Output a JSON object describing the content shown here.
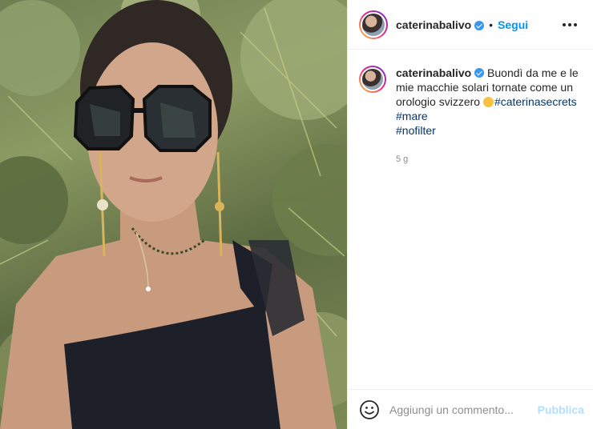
{
  "post": {
    "username": "caterinabalivo",
    "verified_icon": "verified-badge-icon",
    "separator": "•",
    "follow_label": "Segui",
    "more_icon": "more-options-icon"
  },
  "caption": {
    "username": "caterinabalivo",
    "text": "Buondì da me e le mie macchie solari tornate come un orologio svizzero ",
    "emoji_icon": "smiling-face-emoji",
    "hashtags": [
      "#caterinasecrets",
      "#mare",
      "#nofilter"
    ],
    "time_ago": "5 g"
  },
  "comment": {
    "emoji_icon": "smiley-face-icon",
    "placeholder": "Aggiungi un commento...",
    "publish_label": "Pubblica"
  },
  "colors": {
    "link_blue": "#0095f6",
    "hashtag_blue": "#00376b",
    "publish_disabled": "#b2dffc",
    "muted_gray": "#8e8e8e"
  }
}
